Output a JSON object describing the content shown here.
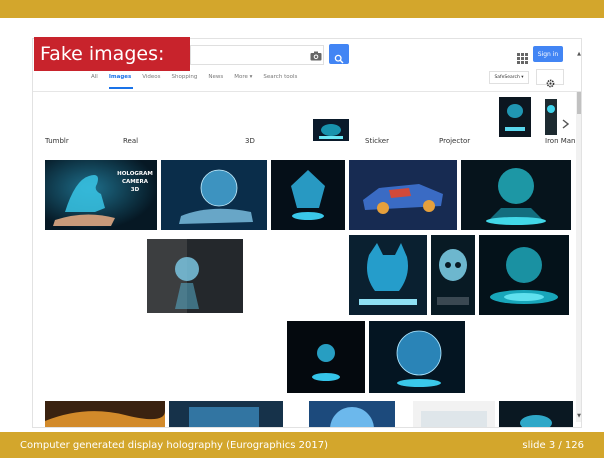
{
  "slide": {
    "title": "Fake images:",
    "footer_left": "Computer generated display holography (Eurographics 2017)",
    "footer_right": "slide 3 / 126"
  },
  "google": {
    "signin_label": "Sign in",
    "tabs": [
      {
        "label": "All"
      },
      {
        "label": "Images",
        "active": true
      },
      {
        "label": "Videos"
      },
      {
        "label": "Shopping"
      },
      {
        "label": "News"
      },
      {
        "label": "More ▾"
      },
      {
        "label": "Search tools"
      }
    ],
    "safesearch_label": "SafeSearch ▾",
    "related": [
      {
        "label": "Tumblr"
      },
      {
        "label": "Real"
      },
      {
        "label": "3D"
      },
      {
        "label": "Sticker"
      },
      {
        "label": "Projector"
      },
      {
        "label": "Iron Man"
      }
    ],
    "results": [
      {
        "name": "hologram-dinosaur",
        "caption": "HOLOGRAM CAMERA 3D"
      },
      {
        "name": "hologram-hands-globe"
      },
      {
        "name": "hologram-crystal-globe"
      },
      {
        "name": "hologram-robot-car"
      },
      {
        "name": "hologram-earth-platform"
      },
      {
        "name": "hologram-businessman-globe"
      },
      {
        "name": "hologram-cat-phone"
      },
      {
        "name": "hologram-skull-phone"
      },
      {
        "name": "hologram-planet-ring"
      },
      {
        "name": "hologram-small-globe"
      },
      {
        "name": "hologram-blue-planet"
      }
    ]
  },
  "colors": {
    "accent": "#d3a62c",
    "title_badge": "#c8232c",
    "google_blue": "#4285f4"
  }
}
